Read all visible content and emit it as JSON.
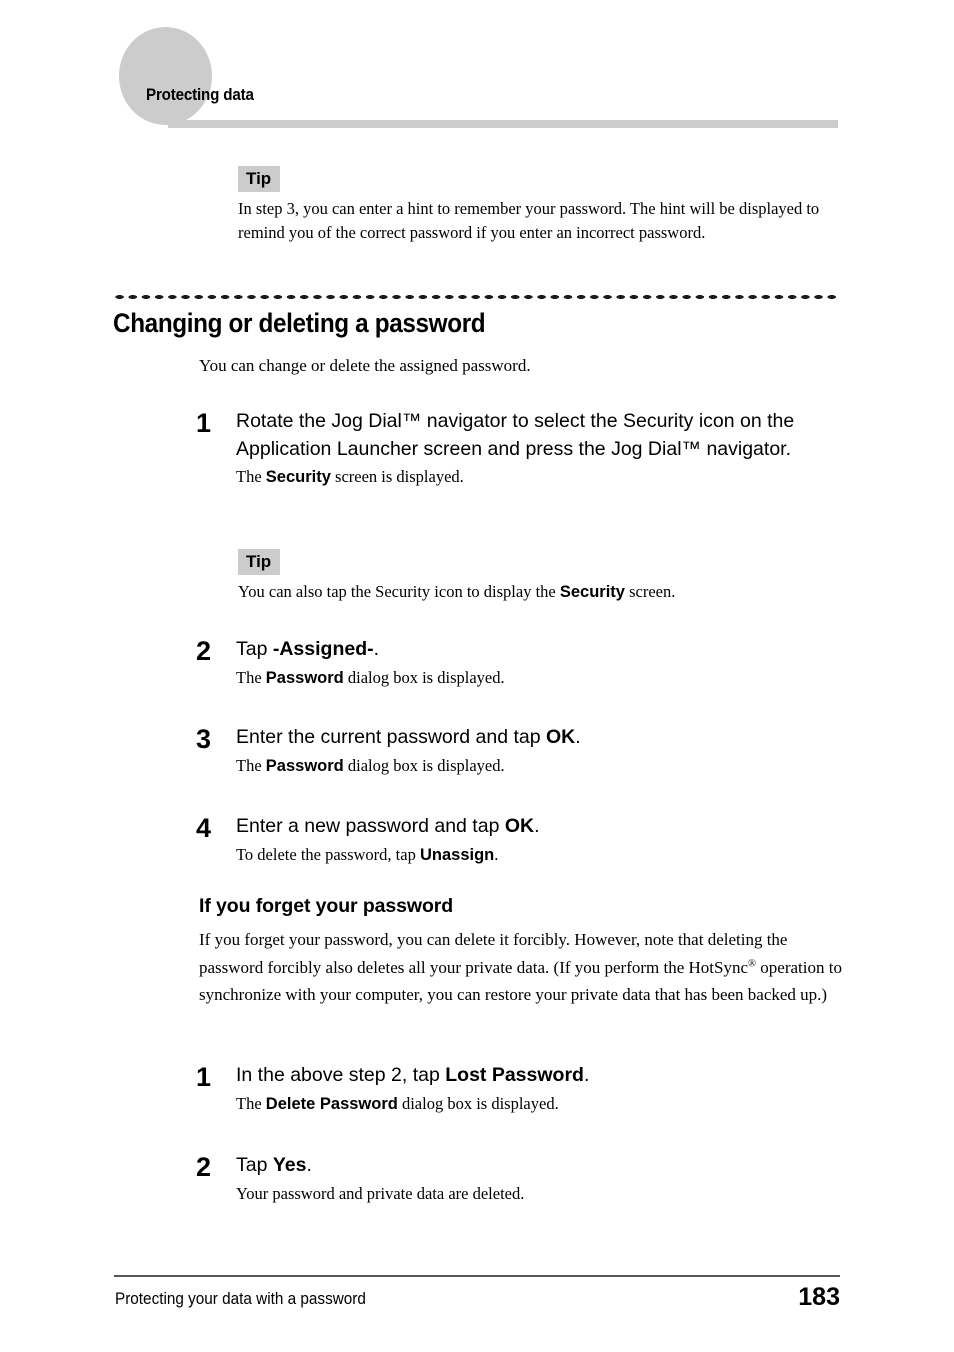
{
  "header": {
    "running_head": "Protecting data"
  },
  "tips": [
    {
      "label": "Tip",
      "body": "In step 3, you can enter a hint to remember your password. The hint will be displayed to remind you of the correct password if you enter an incorrect password."
    },
    {
      "label": "Tip",
      "body_before": "You can also tap the Security icon to display the ",
      "body_bold": "Security",
      "body_after": " screen."
    }
  ],
  "section": {
    "heading": "Changing or deleting a password",
    "intro": "You can change or delete the assigned password."
  },
  "steps_main": [
    {
      "num": "1",
      "main": "Rotate the Jog Dial™ navigator to select the Security icon on the Application Launcher screen and press the Jog Dial™ navigator.",
      "sub_before": "The ",
      "sub_bold": "Security",
      "sub_after": " screen is displayed."
    },
    {
      "num": "2",
      "main_before": "Tap ",
      "main_bold": "-Assigned-",
      "main_after": ".",
      "sub_before": "The ",
      "sub_bold": "Password",
      "sub_after": " dialog box is displayed."
    },
    {
      "num": "3",
      "main_before": "Enter the current password and tap ",
      "main_bold": "OK",
      "main_after": ".",
      "sub_before": "The ",
      "sub_bold": "Password",
      "sub_after": " dialog box is displayed."
    },
    {
      "num": "4",
      "main_before": "Enter a new password and tap ",
      "main_bold": "OK",
      "main_after": ".",
      "sub_before": "To delete the password, tap ",
      "sub_bold": "Unassign",
      "sub_after": "."
    }
  ],
  "subsection": {
    "heading": "If you forget your password",
    "para_part1": "If you forget your password, you can delete it forcibly. However, note that deleting the password forcibly also deletes all your private data. (If you perform the HotSync",
    "para_reg": "®",
    "para_part2": " operation to synchronize with your computer, you can restore your private data that has been backed up.)"
  },
  "steps_forgot": [
    {
      "num": "1",
      "main_before": "In the above step 2, tap ",
      "main_bold": "Lost Password",
      "main_after": ".",
      "sub_before": "The ",
      "sub_bold": "Delete Password",
      "sub_after": " dialog box is displayed."
    },
    {
      "num": "2",
      "main_before": "Tap ",
      "main_bold": "Yes",
      "main_after": ".",
      "sub_plain": "Your password and private data are deleted."
    }
  ],
  "footer": {
    "chapter": "Protecting your data with a password",
    "page_number": "183"
  },
  "colors": {
    "header_gray": "#cccccc",
    "tip_gray": "#cccccc",
    "footer_rule": "#555555",
    "text": "#000000"
  }
}
